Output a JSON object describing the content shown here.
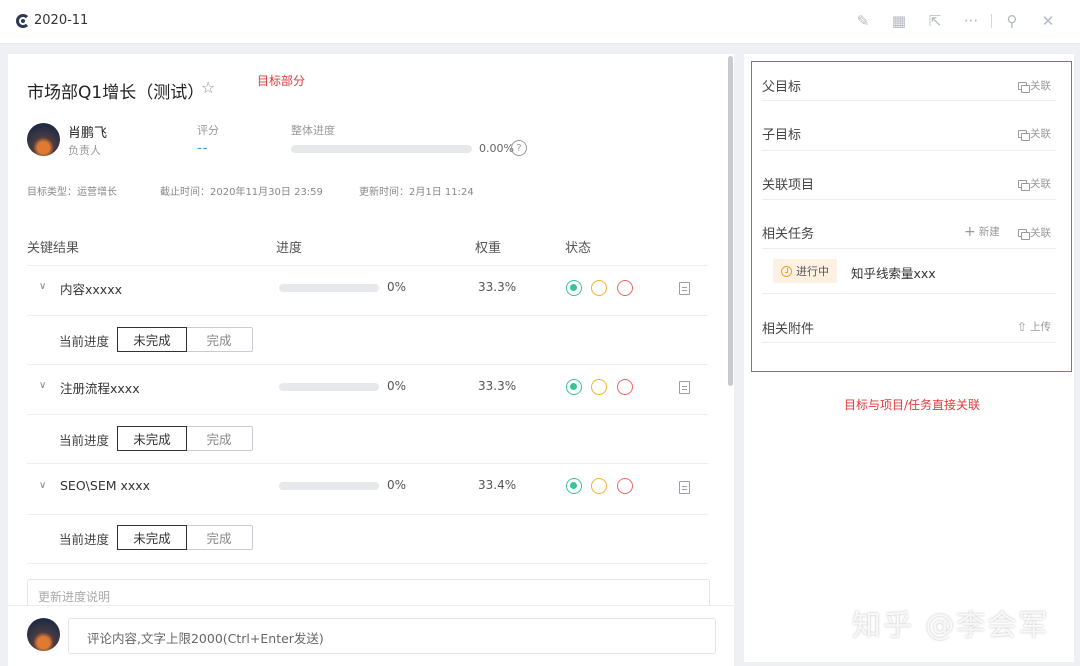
{
  "window": {
    "title": "2020-11"
  },
  "toolbar": {
    "icons": [
      "edit-icon",
      "grid-icon",
      "share-icon",
      "more-icon",
      "pin-icon",
      "close-icon"
    ],
    "more_label": "···"
  },
  "objective": {
    "title": "市场部Q1增长（测试）",
    "annotation": "目标部分",
    "owner_name": "肖鹏飞",
    "owner_role": "负责人",
    "score_label": "评分",
    "score_value": "--",
    "progress_label": "整体进度",
    "progress_value": 0,
    "progress_text": "0.00%",
    "type_label": "目标类型：运营增长",
    "deadline_label": "截止时间：2020年11月30日 23:59",
    "updated_label": "更新时间：2月1日 11:24"
  },
  "table": {
    "headers": {
      "name": "关键结果",
      "progress": "进度",
      "weight": "权重",
      "status": "状态"
    },
    "rows": [
      {
        "name": "内容xxxxx",
        "progress": 0,
        "progress_text": "0%",
        "weight": "33.3%",
        "status": "green",
        "current_label": "当前进度",
        "opt_incomplete": "未完成",
        "opt_complete": "完成",
        "selected": "incomplete"
      },
      {
        "name": "注册流程xxxx",
        "progress": 0,
        "progress_text": "0%",
        "weight": "33.3%",
        "status": "green",
        "current_label": "当前进度",
        "opt_incomplete": "未完成",
        "opt_complete": "完成",
        "selected": "incomplete"
      },
      {
        "name": "SEO\\SEM xxxx",
        "progress": 0,
        "progress_text": "0%",
        "weight": "33.4%",
        "status": "green",
        "current_label": "当前进度",
        "opt_incomplete": "未完成",
        "opt_complete": "完成",
        "selected": "incomplete"
      }
    ]
  },
  "progress_desc": {
    "placeholder": "更新进度说明"
  },
  "comment": {
    "placeholder": "评论内容,文字上限2000(Ctrl+Enter发送)"
  },
  "relations": {
    "parent_label": "父目标",
    "child_label": "子目标",
    "project_label": "关联项目",
    "task_label": "相关任务",
    "attachment_label": "相关附件",
    "link_text": "关联",
    "new_text": "新建",
    "upload_text": "上传",
    "task": {
      "status": "进行中",
      "name": "知乎线索量xxx"
    },
    "annotation": "目标与项目/任务直接关联"
  },
  "watermark": "知乎 @李会军",
  "colors": {
    "accent": "#3a8ee6",
    "status_green": "#3cc29a",
    "status_yellow": "#f0b429",
    "status_red": "#f06565",
    "annotation_red": "#e03a3a"
  }
}
